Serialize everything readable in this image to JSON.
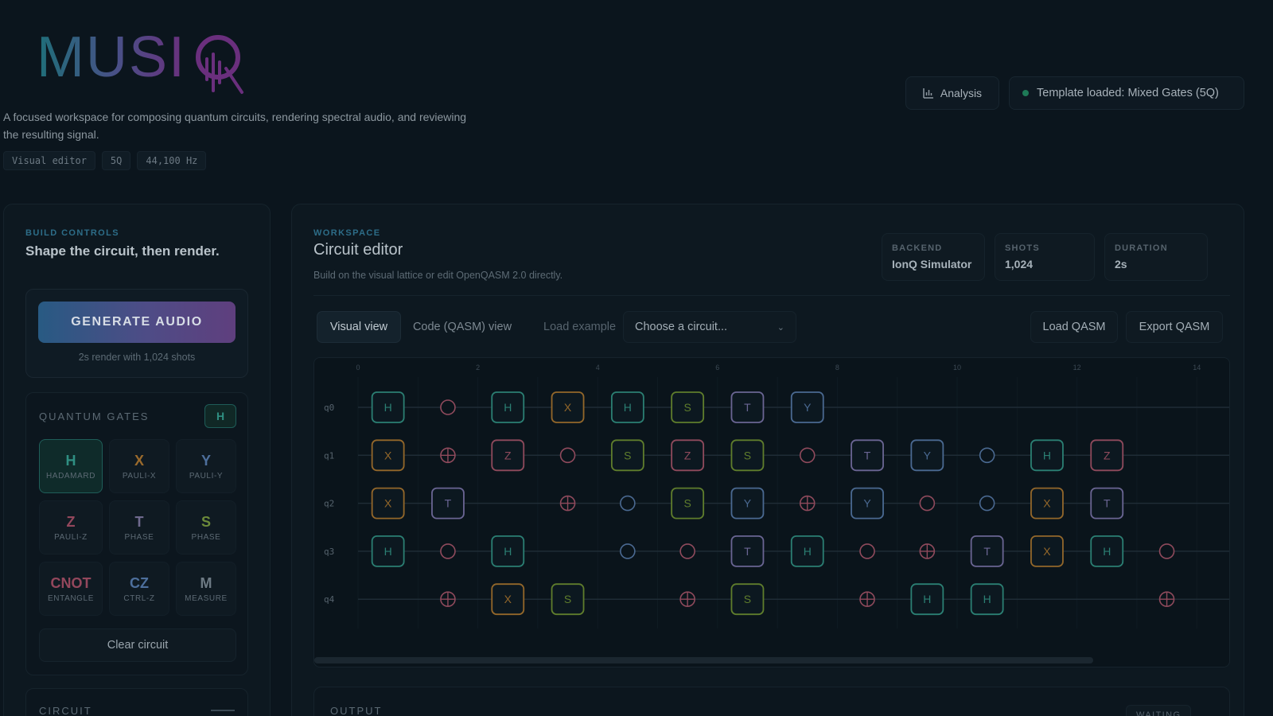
{
  "app": {
    "logo_text": "MUSIQ",
    "tagline": "A focused workspace for composing quantum circuits, rendering spectral audio, and reviewing the resulting signal.",
    "meta_chips": [
      "Visual editor",
      "5Q",
      "44,100 Hz"
    ]
  },
  "header": {
    "analysis_label": "Analysis",
    "status_text": "Template loaded: Mixed Gates (5Q)",
    "status_color": "#1e7a57"
  },
  "build": {
    "eyebrow": "BUILD CONTROLS",
    "title": "Shape the circuit, then render.",
    "generate_label": "GENERATE AUDIO",
    "generate_note": "2s render with 1,024 shots",
    "gates_eyebrow": "QUANTUM GATES",
    "gates_toggle": "H",
    "gates": [
      {
        "symbol": "H",
        "name": "HADAMARD",
        "color": "#2f8f82",
        "selected": true
      },
      {
        "symbol": "X",
        "name": "PAULI-X",
        "color": "#9a6a2c",
        "selected": false
      },
      {
        "symbol": "Y",
        "name": "PAULI-Y",
        "color": "#4d6f9c",
        "selected": false
      },
      {
        "symbol": "Z",
        "name": "PAULI-Z",
        "color": "#93475c",
        "selected": false
      },
      {
        "symbol": "T",
        "name": "PHASE",
        "color": "#6f6a8e",
        "selected": false
      },
      {
        "symbol": "S",
        "name": "PHASE",
        "color": "#6c8a3a",
        "selected": false
      },
      {
        "symbol": "CNOT",
        "name": "ENTANGLE",
        "color": "#93475c",
        "selected": false
      },
      {
        "symbol": "CZ",
        "name": "CTRL-Z",
        "color": "#4d6f9c",
        "selected": false
      },
      {
        "symbol": "M",
        "name": "MEASURE",
        "color": "#6d7a84",
        "selected": false
      }
    ],
    "clear_label": "Clear circuit",
    "circuit_eyebrow": "CIRCUIT"
  },
  "workspace": {
    "eyebrow": "WORKSPACE",
    "title": "Circuit editor",
    "subtitle": "Build on the visual lattice or edit OpenQASM 2.0 directly.",
    "stats": [
      {
        "label": "BACKEND",
        "value": "IonQ Simulator"
      },
      {
        "label": "SHOTS",
        "value": "1,024"
      },
      {
        "label": "DURATION",
        "value": "2s"
      }
    ],
    "tabs": [
      "Visual view",
      "Code (QASM) view"
    ],
    "active_tab": 0,
    "load_example_label": "Load example",
    "select_value": "Choose a circuit...",
    "load_qasm_label": "Load QASM",
    "export_qasm_label": "Export QASM",
    "output_eyebrow": "OUTPUT",
    "output_status": "WAITING"
  },
  "circuit": {
    "columns": 14,
    "tick_labels": [
      "0",
      "2",
      "4",
      "6",
      "8",
      "10",
      "12",
      "14"
    ],
    "qubits": [
      "q0",
      "q1",
      "q2",
      "q3",
      "q4"
    ],
    "gate_colors": {
      "H": "#2b7f73",
      "X": "#93672a",
      "Y": "#4a6991",
      "Z": "#8f4a5c",
      "S": "#5f7d2c",
      "T": "#6a6593",
      "ctrl": "#8f4a5c",
      "target": "#8f4a5c",
      "ctrl_blue": "#4a6991"
    },
    "gates": [
      {
        "q": 0,
        "col": 0.5,
        "g": "H"
      },
      {
        "q": 0,
        "col": 1.5,
        "g": "ctrl"
      },
      {
        "q": 0,
        "col": 2.5,
        "g": "H"
      },
      {
        "q": 0,
        "col": 3.5,
        "g": "X"
      },
      {
        "q": 0,
        "col": 4.5,
        "g": "H"
      },
      {
        "q": 0,
        "col": 5.5,
        "g": "S"
      },
      {
        "q": 0,
        "col": 6.5,
        "g": "T"
      },
      {
        "q": 0,
        "col": 7.5,
        "g": "Y"
      },
      {
        "q": 1,
        "col": 0.5,
        "g": "X"
      },
      {
        "q": 1,
        "col": 1.5,
        "g": "target"
      },
      {
        "q": 1,
        "col": 2.5,
        "g": "Z"
      },
      {
        "q": 1,
        "col": 3.5,
        "g": "ctrl"
      },
      {
        "q": 1,
        "col": 4.5,
        "g": "S"
      },
      {
        "q": 1,
        "col": 5.5,
        "g": "Z"
      },
      {
        "q": 1,
        "col": 6.5,
        "g": "S"
      },
      {
        "q": 1,
        "col": 7.5,
        "g": "ctrl"
      },
      {
        "q": 1,
        "col": 8.5,
        "g": "T"
      },
      {
        "q": 1,
        "col": 9.5,
        "g": "Y"
      },
      {
        "q": 1,
        "col": 10.5,
        "g": "ctrl_blue"
      },
      {
        "q": 1,
        "col": 11.5,
        "g": "H"
      },
      {
        "q": 1,
        "col": 12.5,
        "g": "Z"
      },
      {
        "q": 2,
        "col": 0.5,
        "g": "X"
      },
      {
        "q": 2,
        "col": 1.5,
        "g": "T"
      },
      {
        "q": 2,
        "col": 3.5,
        "g": "target"
      },
      {
        "q": 2,
        "col": 4.5,
        "g": "ctrl_blue"
      },
      {
        "q": 2,
        "col": 5.5,
        "g": "S"
      },
      {
        "q": 2,
        "col": 6.5,
        "g": "Y"
      },
      {
        "q": 2,
        "col": 7.5,
        "g": "target"
      },
      {
        "q": 2,
        "col": 8.5,
        "g": "Y"
      },
      {
        "q": 2,
        "col": 9.5,
        "g": "ctrl"
      },
      {
        "q": 2,
        "col": 10.5,
        "g": "ctrl_blue"
      },
      {
        "q": 2,
        "col": 11.5,
        "g": "X"
      },
      {
        "q": 2,
        "col": 12.5,
        "g": "T"
      },
      {
        "q": 3,
        "col": 0.5,
        "g": "H"
      },
      {
        "q": 3,
        "col": 1.5,
        "g": "ctrl"
      },
      {
        "q": 3,
        "col": 2.5,
        "g": "H"
      },
      {
        "q": 3,
        "col": 4.5,
        "g": "ctrl_blue"
      },
      {
        "q": 3,
        "col": 5.5,
        "g": "ctrl"
      },
      {
        "q": 3,
        "col": 6.5,
        "g": "T"
      },
      {
        "q": 3,
        "col": 7.5,
        "g": "H"
      },
      {
        "q": 3,
        "col": 8.5,
        "g": "ctrl"
      },
      {
        "q": 3,
        "col": 9.5,
        "g": "target"
      },
      {
        "q": 3,
        "col": 10.5,
        "g": "T"
      },
      {
        "q": 3,
        "col": 11.5,
        "g": "X"
      },
      {
        "q": 3,
        "col": 12.5,
        "g": "H"
      },
      {
        "q": 3,
        "col": 13.5,
        "g": "ctrl"
      },
      {
        "q": 4,
        "col": 1.5,
        "g": "target"
      },
      {
        "q": 4,
        "col": 2.5,
        "g": "X"
      },
      {
        "q": 4,
        "col": 3.5,
        "g": "S"
      },
      {
        "q": 4,
        "col": 5.5,
        "g": "target"
      },
      {
        "q": 4,
        "col": 6.5,
        "g": "S"
      },
      {
        "q": 4,
        "col": 8.5,
        "g": "target"
      },
      {
        "q": 4,
        "col": 9.5,
        "g": "H"
      },
      {
        "q": 4,
        "col": 10.5,
        "g": "H"
      },
      {
        "q": 4,
        "col": 13.5,
        "g": "target"
      }
    ]
  }
}
